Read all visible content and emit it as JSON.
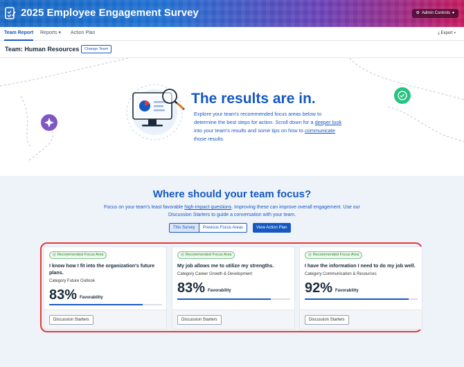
{
  "header": {
    "title": "2025 Employee Engagement Survey",
    "admin_label": "Admin Controls",
    "colors": {
      "primary": "#1558c0",
      "accent_red": "#e53935",
      "badge_green": "#2e7d32"
    }
  },
  "nav": {
    "items": [
      {
        "label": "Team Report",
        "active": true
      },
      {
        "label": "Reports"
      },
      {
        "label": "Action Plan"
      }
    ],
    "export_label": "Export"
  },
  "team": {
    "title": "Team: Human Resources",
    "change_label": "Change Team"
  },
  "hero": {
    "title": "The results are in.",
    "text_1": "Explore your team's recommended focus areas below to determine the best steps for action. Scroll down for a ",
    "link_1": "deeper look ",
    "text_2": "into your team's results and some tips on how to ",
    "link_2": "communicate",
    "text_3": " those results."
  },
  "focus": {
    "title": "Where should your team focus?",
    "desc_1": "Focus on your team's least favorable ",
    "desc_link": "high-impact questions",
    "desc_2": ". Improving these can improve overall engagement. Use our Discussion Starters to guide a conversation with your team.",
    "tabs": [
      "This Survey",
      "Previous Focus Areas"
    ],
    "action_label": "View Action Plan"
  },
  "cards": [
    {
      "badge": "Recommended Focus Area",
      "question": "I know how I fit into the organization's future plans.",
      "category": "Category Future Outlook",
      "percent": "83%",
      "fraction": 0.83,
      "fav_label": "Favorability",
      "button": "Discussion Starters"
    },
    {
      "badge": "Recommended Focus Area",
      "question": "My job allows me to utilize my strengths.",
      "category": "Category Career Growth & Development",
      "percent": "83%",
      "fraction": 0.83,
      "fav_label": "Favorability",
      "button": "Discussion Starters"
    },
    {
      "badge": "Recommended Focus Area",
      "question": "I have the information I need to do my job well.",
      "category": "Category Communication & Resources",
      "percent": "92%",
      "fraction": 0.92,
      "fav_label": "Favorability",
      "button": "Discussion Starters"
    }
  ]
}
